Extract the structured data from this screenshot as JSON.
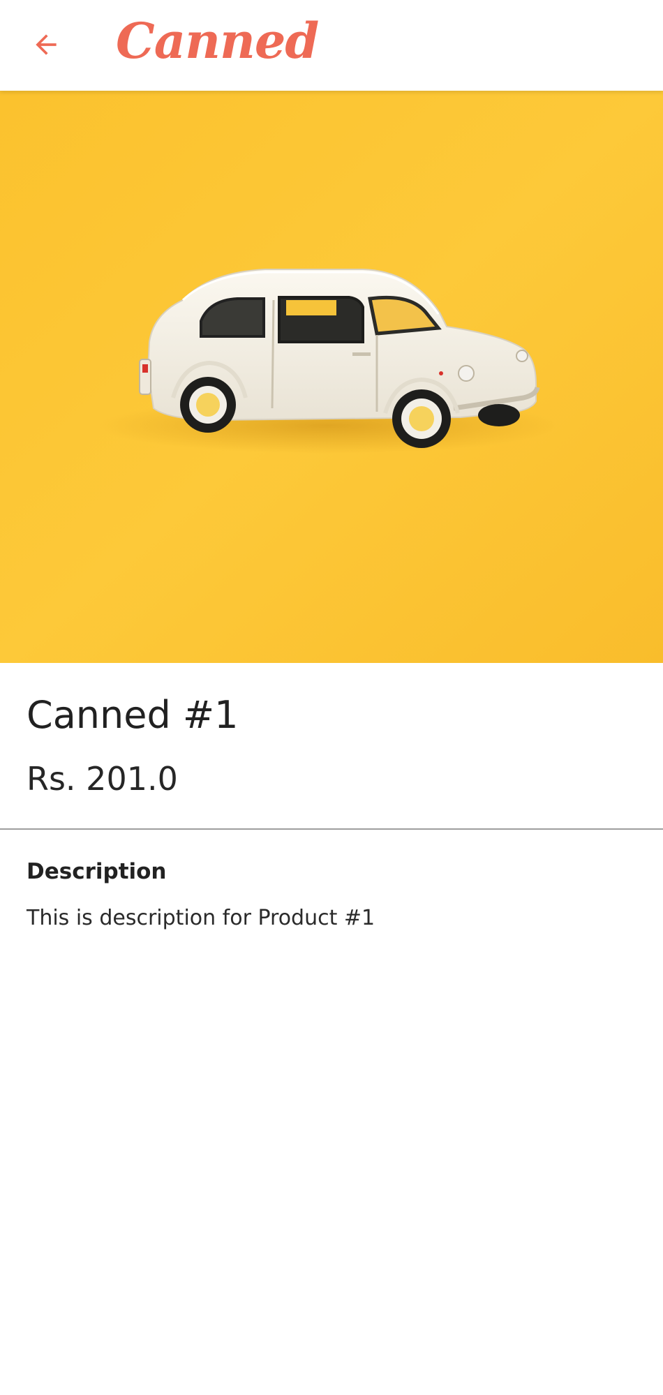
{
  "app_bar": {
    "back_icon": "arrow-left-icon",
    "title": "Canned"
  },
  "product": {
    "image_alt": "toy-car-photo",
    "name": "Canned #1",
    "price": "Rs. 201.0"
  },
  "description": {
    "heading": "Description",
    "text": "This is description for Product #1"
  },
  "colors": {
    "accent": "#ee6a55",
    "hero_bg": "#fbc531",
    "divider": "#9e9e9e",
    "text_primary": "#212121"
  }
}
